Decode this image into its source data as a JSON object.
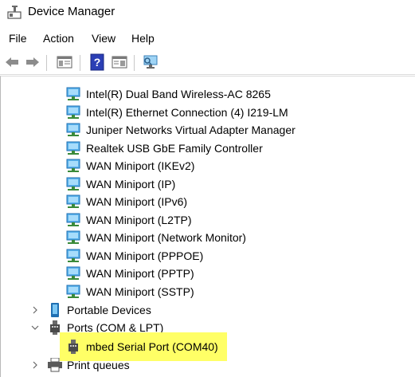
{
  "window": {
    "title": "Device Manager"
  },
  "menu": [
    "File",
    "Action",
    "View",
    "Help"
  ],
  "toolbar": {
    "buttons": [
      "back",
      "forward",
      "show-hide-console-tree",
      "help",
      "properties",
      "scan-hardware"
    ]
  },
  "tree": {
    "network_adapters": [
      "Intel(R) Dual Band Wireless-AC 8265",
      "Intel(R) Ethernet Connection (4) I219-LM",
      "Juniper Networks Virtual Adapter Manager",
      "Realtek USB GbE Family Controller",
      "WAN Miniport (IKEv2)",
      "WAN Miniport (IP)",
      "WAN Miniport (IPv6)",
      "WAN Miniport (L2TP)",
      "WAN Miniport (Network Monitor)",
      "WAN Miniport (PPPOE)",
      "WAN Miniport (PPTP)",
      "WAN Miniport (SSTP)"
    ],
    "portable_devices": "Portable Devices",
    "ports": "Ports (COM & LPT)",
    "port_child": "mbed Serial Port (COM40)",
    "print_queues": "Print queues"
  },
  "colors": {
    "highlight": "#ffff66",
    "net_icon": "#2f8fd6",
    "selection_note": "highlighter yellow"
  }
}
